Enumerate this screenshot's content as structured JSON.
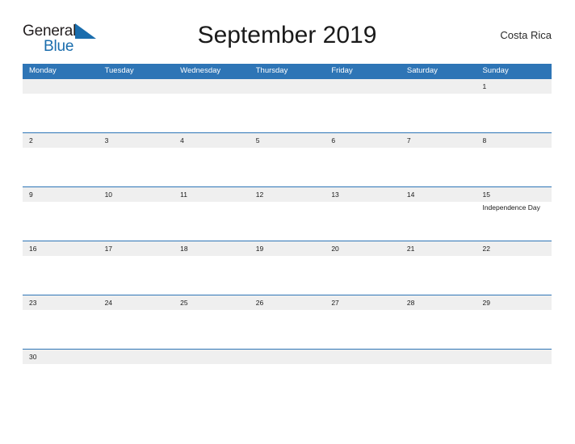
{
  "brand": {
    "name_part1": "General",
    "name_part2": "Blue",
    "flag_icon": "blue-triangle-flag-icon",
    "primary_color": "#2e75b6",
    "dark_color": "#231f20",
    "blue_text_color": "#1a6dad"
  },
  "header": {
    "title": "September 2019",
    "country": "Costa Rica"
  },
  "calendar": {
    "month": "September",
    "year": "2019",
    "week_start": "Monday",
    "weekdays": [
      "Monday",
      "Tuesday",
      "Wednesday",
      "Thursday",
      "Friday",
      "Saturday",
      "Sunday"
    ],
    "header_bg": "#2e75b6",
    "band_bg": "#efefef",
    "rule_color": "#2e75b6",
    "weeks": [
      {
        "days": [
          {
            "num": "",
            "event": ""
          },
          {
            "num": "",
            "event": ""
          },
          {
            "num": "",
            "event": ""
          },
          {
            "num": "",
            "event": ""
          },
          {
            "num": "",
            "event": ""
          },
          {
            "num": "",
            "event": ""
          },
          {
            "num": "1",
            "event": ""
          }
        ]
      },
      {
        "days": [
          {
            "num": "2",
            "event": ""
          },
          {
            "num": "3",
            "event": ""
          },
          {
            "num": "4",
            "event": ""
          },
          {
            "num": "5",
            "event": ""
          },
          {
            "num": "6",
            "event": ""
          },
          {
            "num": "7",
            "event": ""
          },
          {
            "num": "8",
            "event": ""
          }
        ]
      },
      {
        "days": [
          {
            "num": "9",
            "event": ""
          },
          {
            "num": "10",
            "event": ""
          },
          {
            "num": "11",
            "event": ""
          },
          {
            "num": "12",
            "event": ""
          },
          {
            "num": "13",
            "event": ""
          },
          {
            "num": "14",
            "event": ""
          },
          {
            "num": "15",
            "event": "Independence Day"
          }
        ]
      },
      {
        "days": [
          {
            "num": "16",
            "event": ""
          },
          {
            "num": "17",
            "event": ""
          },
          {
            "num": "18",
            "event": ""
          },
          {
            "num": "19",
            "event": ""
          },
          {
            "num": "20",
            "event": ""
          },
          {
            "num": "21",
            "event": ""
          },
          {
            "num": "22",
            "event": ""
          }
        ]
      },
      {
        "days": [
          {
            "num": "23",
            "event": ""
          },
          {
            "num": "24",
            "event": ""
          },
          {
            "num": "25",
            "event": ""
          },
          {
            "num": "26",
            "event": ""
          },
          {
            "num": "27",
            "event": ""
          },
          {
            "num": "28",
            "event": ""
          },
          {
            "num": "29",
            "event": ""
          }
        ]
      },
      {
        "days": [
          {
            "num": "30",
            "event": ""
          },
          {
            "num": "",
            "event": ""
          },
          {
            "num": "",
            "event": ""
          },
          {
            "num": "",
            "event": ""
          },
          {
            "num": "",
            "event": ""
          },
          {
            "num": "",
            "event": ""
          },
          {
            "num": "",
            "event": ""
          }
        ]
      }
    ]
  }
}
